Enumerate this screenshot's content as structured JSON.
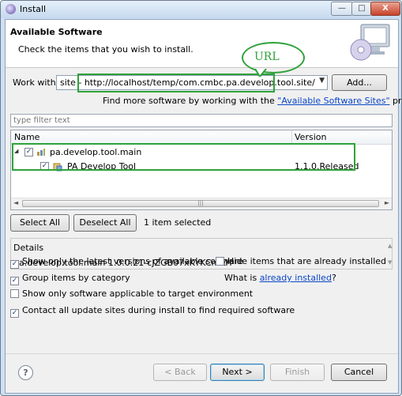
{
  "window": {
    "title": "Install",
    "min_glyph": "—",
    "max_glyph": "□",
    "close_glyph": "X"
  },
  "banner": {
    "title": "Available Software",
    "description": "Check the items that you wish to install."
  },
  "work_with": {
    "label": "Work with:",
    "value": "site - http://localhost/temp/com.cmbc.pa.develop.tool.site/",
    "add_label": "Add..."
  },
  "find_more": {
    "prefix": "Find more software by working with the",
    "link": "\"Available Software Sites\"",
    "suffix": "preferences."
  },
  "filter": {
    "placeholder": "type filter text"
  },
  "tree": {
    "columns": [
      "Name",
      "Version"
    ],
    "rows": [
      {
        "name": "pa.develop.tool.main",
        "version": "",
        "checked": true,
        "expanded": true
      },
      {
        "name": "PA Develop Tool",
        "version": "1.1.0.Released",
        "checked": true
      }
    ],
    "scroll_glyphs": {
      "left": "◄",
      "right": "►",
      "grip": "|||"
    },
    "expand_glyph": "◢"
  },
  "selection": {
    "select_all": "Select All",
    "deselect_all": "Deselect All",
    "status": "1 item selected"
  },
  "details": {
    "title": "Details",
    "text": "pa.develop.tool.main 1.0.0.21-cJZGB07xKYKCmKH"
  },
  "options": {
    "latest_only": {
      "label": "Show only the latest versions of available software",
      "checked": true
    },
    "hide_installed": {
      "label": "Hide items that are already installed",
      "checked": false
    },
    "group_by_category": {
      "label": "Group items by category",
      "checked": true
    },
    "what_is": {
      "prefix": "What is",
      "link": "already installed",
      "suffix": "?"
    },
    "target_env": {
      "label": "Show only software applicable to target environment",
      "checked": false
    },
    "contact_sites": {
      "label": "Contact all update sites during install to find required software",
      "checked": true
    }
  },
  "footer": {
    "help": "?",
    "back": "< Back",
    "next": "Next >",
    "finish": "Finish",
    "cancel": "Cancel"
  },
  "annotation": {
    "text": "URL",
    "color": "#2fa23a"
  }
}
